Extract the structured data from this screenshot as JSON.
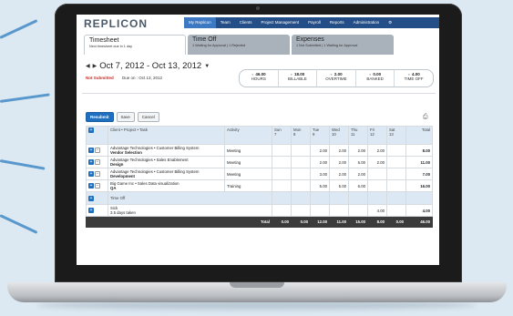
{
  "app": {
    "logo": "REPLICON",
    "nav": [
      "My Replicon",
      "Team",
      "Clients",
      "Project Management",
      "Payroll",
      "Reports",
      "Administration"
    ],
    "nav_active": 0,
    "settings_icon": "gear-icon"
  },
  "tabs": [
    {
      "title": "Timesheet",
      "sub": "Next timesheet due in 1 day"
    },
    {
      "title": "Time Off",
      "sub": "1 Waiting for Approval | 1 Rejected"
    },
    {
      "title": "Expenses",
      "sub": "1 Not Submitted | 1 Waiting for Approval"
    }
  ],
  "period": {
    "range": "Oct 7, 2012 - Oct 13, 2012",
    "status": "Not Submitted",
    "due": "Due on : Oct 13, 2012"
  },
  "summary": [
    {
      "value": "46.00",
      "label": "HOURS"
    },
    {
      "value": "18.00",
      "label": "BILLABLE"
    },
    {
      "value": "2.00",
      "label": "OVERTIME"
    },
    {
      "value": "0.00",
      "label": "BANKED"
    },
    {
      "value": "4.00",
      "label": "TIME OFF"
    }
  ],
  "toolbar": {
    "resubmit": "Resubmit",
    "save": "Save",
    "cancel": "Cancel"
  },
  "grid": {
    "headers": {
      "client": "Client • Project • Task",
      "activity": "Activity",
      "days": [
        {
          "d": "Sun",
          "n": "7"
        },
        {
          "d": "Mon",
          "n": "8"
        },
        {
          "d": "Tue",
          "n": "9"
        },
        {
          "d": "Wed",
          "n": "10"
        },
        {
          "d": "Thu",
          "n": "11"
        },
        {
          "d": "Fri",
          "n": "12"
        },
        {
          "d": "Sat",
          "n": "13"
        }
      ],
      "total": "Total"
    },
    "rows": [
      {
        "client": "Advantage Technologies • Customer Billing System",
        "task": "Vendor Selection",
        "activity": "Meeting",
        "days": [
          "",
          "",
          "2.00",
          "2.00",
          "2.00",
          "2.00",
          ""
        ],
        "total": "8.00"
      },
      {
        "client": "Advantage Technologies • Sales Enablement",
        "task": "Design",
        "activity": "Meeting",
        "days": [
          "",
          "",
          "2.00",
          "2.00",
          "5.00",
          "2.00",
          ""
        ],
        "total": "11.00"
      },
      {
        "client": "Advantage Technologies • Customer Billing System",
        "task": "Development",
        "activity": "Meeting",
        "days": [
          "",
          "",
          "3.00",
          "2.00",
          "2.00",
          "",
          ""
        ],
        "total": "7.00"
      },
      {
        "client": "Big Game Inc • Sales Data visualization",
        "task": "QA",
        "activity": "Training",
        "days": [
          "",
          "",
          "5.00",
          "5.00",
          "6.00",
          "",
          ""
        ],
        "total": "16.00"
      }
    ],
    "timeoff_header": "Time Off",
    "timeoff_rows": [
      {
        "name": "Sick",
        "sub": "3.5 days taken",
        "days": [
          "",
          "",
          "",
          "",
          "",
          "4.00",
          ""
        ],
        "total": "4.00"
      }
    ],
    "total_row": {
      "label": "Total",
      "days": [
        "0.00",
        "0.00",
        "12.00",
        "11.00",
        "15.00",
        "8.00",
        "0.00"
      ],
      "total": "46.00"
    }
  }
}
